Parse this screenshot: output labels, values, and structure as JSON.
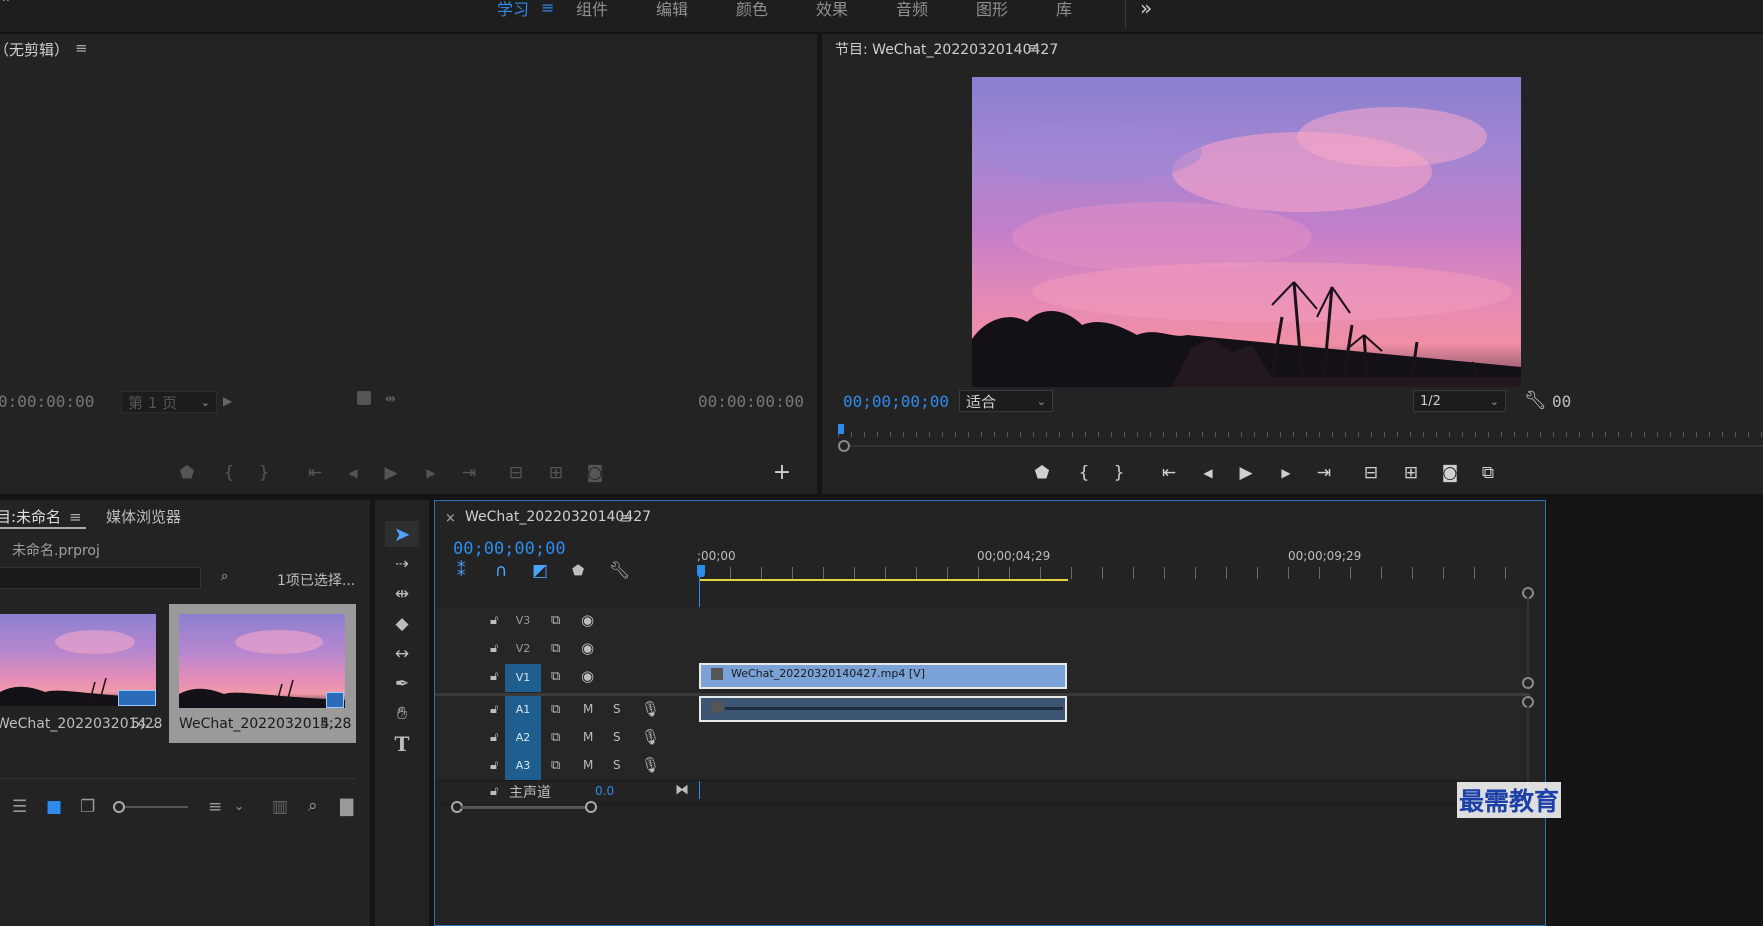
{
  "workspace_tabs": [
    {
      "label": "学习",
      "active": true
    },
    {
      "label": "组件",
      "active": false
    },
    {
      "label": "编辑",
      "active": false
    },
    {
      "label": "颜色",
      "active": false
    },
    {
      "label": "效果",
      "active": false
    },
    {
      "label": "音频",
      "active": false
    },
    {
      "label": "图形",
      "active": false
    },
    {
      "label": "库",
      "active": false
    }
  ],
  "workspace_menu_icon": "≡",
  "more_icon": "»",
  "source": {
    "title": "（无剪辑）",
    "timecode_left": "0:00:00:00",
    "page_select": "第 1 页",
    "timecode_right": "00:00:00:00"
  },
  "program": {
    "title": "节目: WeChat_20220320140427",
    "timecode": "00;00;00;00",
    "fit": "适合",
    "resolution": "1/2",
    "timecode_right": "00"
  },
  "project": {
    "tabs": [
      {
        "label": "目:未命名",
        "active": true
      },
      {
        "label": "媒体浏览器",
        "active": false
      }
    ],
    "filename": "未命名.prproj",
    "selection_status": "1项已选择...",
    "items": [
      {
        "name": "WeChat_2022032014...",
        "duration": "5;28",
        "selected": false
      },
      {
        "name": "WeChat_2022032014...",
        "duration": "5;28",
        "selected": true
      }
    ]
  },
  "timeline": {
    "tab_title": "WeChat_20220320140427",
    "timecode": "00;00;00;00",
    "ruler_labels": [
      ";00;00",
      "00;00;04;29",
      "00;00;09;29"
    ],
    "tracks": [
      {
        "id": "V3",
        "selected": false
      },
      {
        "id": "V2",
        "selected": false
      },
      {
        "id": "V1",
        "selected": true
      },
      {
        "id": "A1",
        "selected": true
      },
      {
        "id": "A2",
        "selected": true
      },
      {
        "id": "A3",
        "selected": true
      }
    ],
    "audio_m": "M",
    "audio_s": "S",
    "master_label": "主声道",
    "master_value": "0.0",
    "clip_video_label": "WeChat_20220320140427.mp4 [V]"
  },
  "watermark": "最需教育",
  "colors": {
    "accent_blue": "#2d8ceb",
    "panel_bg": "#232323",
    "clip_video": "#7aa2d6",
    "clip_audio": "#3b5573",
    "track_selected": "#1f5f8f",
    "work_area": "#e6d23a"
  },
  "icons": {
    "source_controls": [
      "marker-icon",
      "mark-in-icon",
      "mark-out-icon",
      "go-to-in-icon",
      "step-back-icon",
      "play-icon",
      "step-forward-icon",
      "go-to-out-icon",
      "insert-icon",
      "overwrite-icon",
      "export-frame-icon",
      "add-button-icon"
    ],
    "program_controls": [
      "marker-icon",
      "mark-in-icon",
      "mark-out-icon",
      "go-to-in-icon",
      "step-back-icon",
      "play-icon",
      "step-forward-icon",
      "go-to-out-icon",
      "lift-icon",
      "extract-icon",
      "export-frame-icon",
      "comparison-view-icon"
    ],
    "tools": [
      "selection-tool-icon",
      "track-select-tool-icon",
      "ripple-edit-tool-icon",
      "razor-tool-icon",
      "slip-tool-icon",
      "pen-tool-icon",
      "hand-tool-icon",
      "type-tool-icon"
    ]
  }
}
